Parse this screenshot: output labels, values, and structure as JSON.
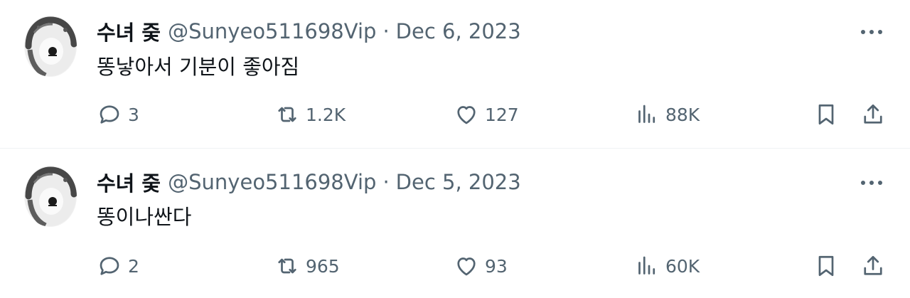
{
  "tweets": [
    {
      "display_name": "수녀 줒",
      "handle": "@Sunyeo511698Vip",
      "separator": "·",
      "date": "Dec 6, 2023",
      "text": "똥낳아서 기분이 좋아짐",
      "stats": {
        "replies": "3",
        "retweets": "1.2K",
        "likes": "127",
        "views": "88K"
      }
    },
    {
      "display_name": "수녀 줒",
      "handle": "@Sunyeo511698Vip",
      "separator": "·",
      "date": "Dec 5, 2023",
      "text": "똥이나싼다",
      "stats": {
        "replies": "2",
        "retweets": "965",
        "likes": "93",
        "views": "60K"
      }
    }
  ],
  "icons": {
    "avatar": "profile-avatar",
    "more": "more-dots-icon",
    "reply": "reply-bubble-icon",
    "retweet": "retweet-icon",
    "like": "heart-icon",
    "views": "views-bar-icon",
    "bookmark": "bookmark-icon",
    "share": "share-icon"
  },
  "colors": {
    "text": "#0f1419",
    "secondary": "#536471",
    "divider": "#eff3f4",
    "background": "#ffffff"
  }
}
